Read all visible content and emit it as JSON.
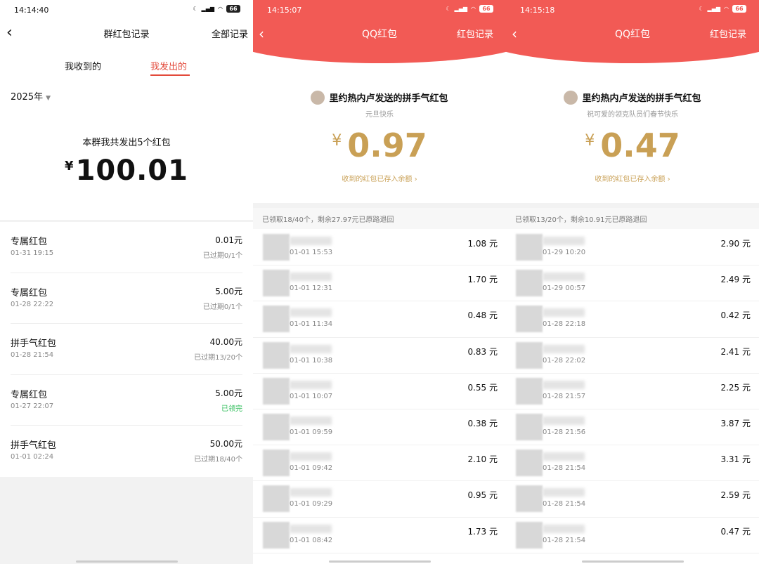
{
  "panel1": {
    "status_time": "14:14:40",
    "battery": "66",
    "title": "群红包记录",
    "all_records": "全部记录",
    "tab_received": "我收到的",
    "tab_sent": "我发出的",
    "year": "2025年",
    "summary": "本群我共发出5个红包",
    "currency": "¥",
    "total": "100.01",
    "items": [
      {
        "name": "专属红包",
        "time": "01-31 19:15",
        "amount": "0.01元",
        "status": "已过期0/1个"
      },
      {
        "name": "专属红包",
        "time": "01-28 22:22",
        "amount": "5.00元",
        "status": "已过期0/1个"
      },
      {
        "name": "拼手气红包",
        "time": "01-28 21:54",
        "amount": "40.00元",
        "status": "已过期13/20个"
      },
      {
        "name": "专属红包",
        "time": "01-27 22:07",
        "amount": "5.00元",
        "status": "已领完"
      },
      {
        "name": "拼手气红包",
        "time": "01-01 02:24",
        "amount": "50.00元",
        "status": "已过期18/40个"
      }
    ]
  },
  "panel2": {
    "status_time": "14:15:07",
    "battery": "66",
    "title": "QQ红包",
    "records": "红包记录",
    "sender": "里约热内卢发送的拼手气红包",
    "wish": "元旦快乐",
    "currency": "¥",
    "amount": "0.97",
    "saved": "收到的红包已存入余额 ›",
    "claimed": "已领取18/40个，剩余27.97元已原路退回",
    "rows": [
      {
        "time": "01-01 15:53",
        "amount": "1.08 元"
      },
      {
        "time": "01-01 12:31",
        "amount": "1.70 元"
      },
      {
        "time": "01-01 11:34",
        "amount": "0.48 元"
      },
      {
        "time": "01-01 10:38",
        "amount": "0.83 元"
      },
      {
        "time": "01-01 10:07",
        "amount": "0.55 元"
      },
      {
        "time": "01-01 09:59",
        "amount": "0.38 元"
      },
      {
        "time": "01-01 09:42",
        "amount": "2.10 元"
      },
      {
        "time": "01-01 09:29",
        "amount": "0.95 元"
      },
      {
        "time": "01-01 08:42",
        "amount": "1.73 元"
      }
    ]
  },
  "panel3": {
    "status_time": "14:15:18",
    "battery": "66",
    "title": "QQ红包",
    "records": "红包记录",
    "sender": "里约热内卢发送的拼手气红包",
    "wish": "祝可爱的领克队员们春节快乐",
    "currency": "¥",
    "amount": "0.47",
    "saved": "收到的红包已存入余额 ›",
    "claimed": "已领取13/20个，剩余10.91元已原路退回",
    "rows": [
      {
        "time": "01-29 10:20",
        "amount": "2.90 元"
      },
      {
        "time": "01-29 00:57",
        "amount": "2.49 元"
      },
      {
        "time": "01-28 22:18",
        "amount": "0.42 元"
      },
      {
        "time": "01-28 22:02",
        "amount": "2.41 元"
      },
      {
        "time": "01-28 21:57",
        "amount": "2.25 元"
      },
      {
        "time": "01-28 21:56",
        "amount": "3.87 元"
      },
      {
        "time": "01-28 21:54",
        "amount": "3.31 元"
      },
      {
        "time": "01-28 21:54",
        "amount": "2.59 元"
      },
      {
        "time": "01-28 21:54",
        "amount": "0.47 元"
      }
    ]
  },
  "colors": {
    "red": "#f25a55",
    "gold": "#c9a055",
    "green": "#2ebd59",
    "tab_active": "#e34a3b"
  }
}
